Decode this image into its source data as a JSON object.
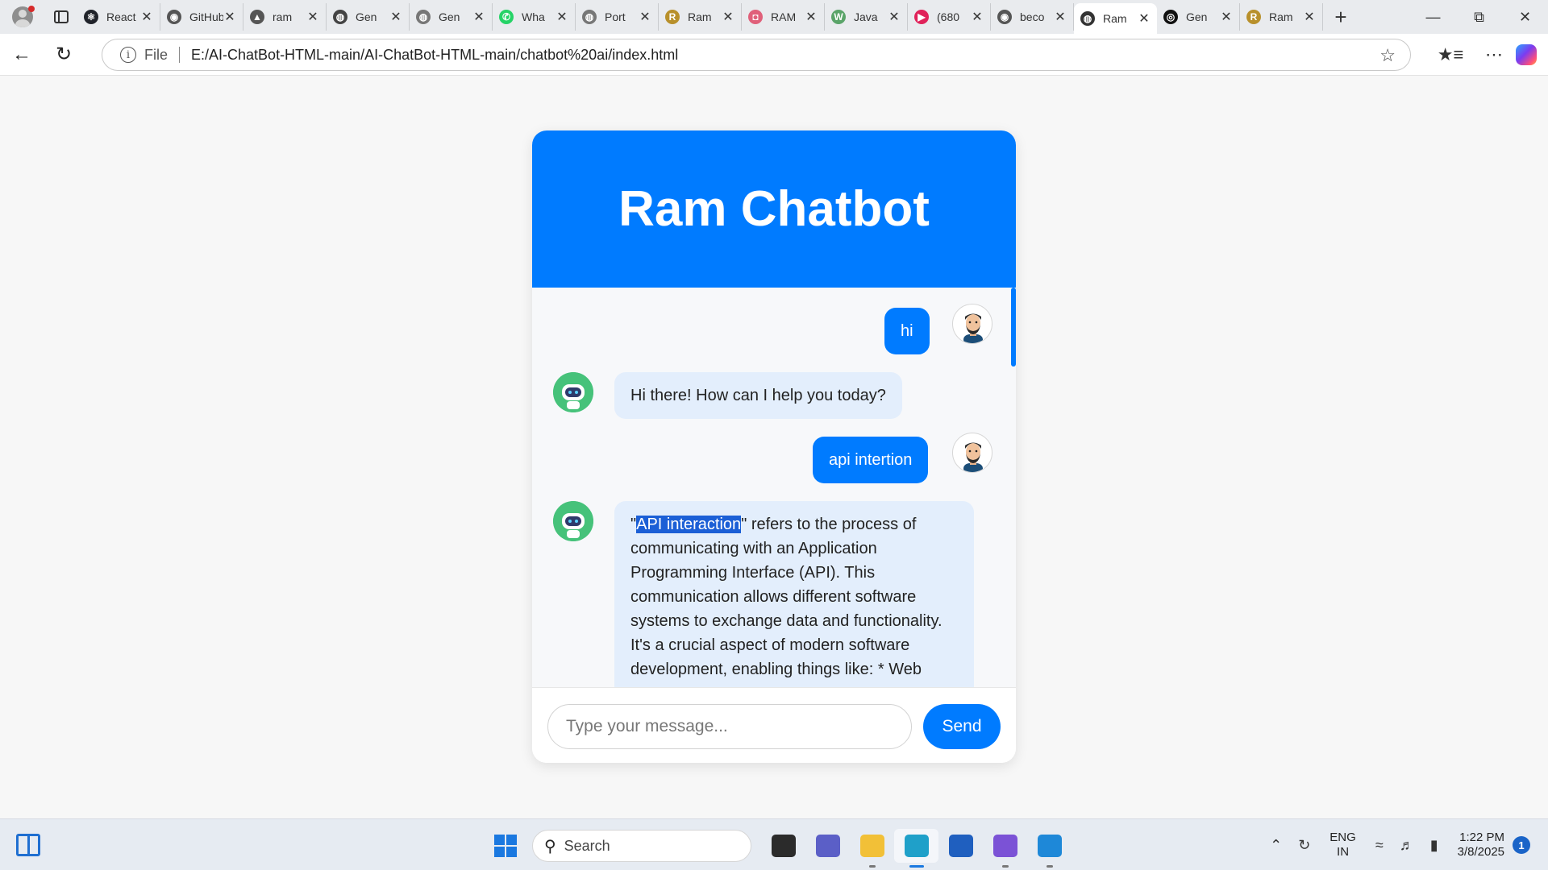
{
  "browser": {
    "tabs": [
      {
        "title": "React",
        "fav_color": "#20232a",
        "fav_glyph": "⚛"
      },
      {
        "title": "GitHub",
        "fav_color": "#555555",
        "fav_glyph": "◉"
      },
      {
        "title": "ram",
        "fav_color": "#555555",
        "fav_glyph": "▲"
      },
      {
        "title": "Gen",
        "fav_color": "#444444",
        "fav_glyph": "◍"
      },
      {
        "title": "Gen",
        "fav_color": "#777777",
        "fav_glyph": "◍"
      },
      {
        "title": "Wha",
        "fav_color": "#25d366",
        "fav_glyph": "✆"
      },
      {
        "title": "Port",
        "fav_color": "#777777",
        "fav_glyph": "◍"
      },
      {
        "title": "Ram",
        "fav_color": "#b8902b",
        "fav_glyph": "R"
      },
      {
        "title": "RAM",
        "fav_color": "#e0607a",
        "fav_glyph": "◘"
      },
      {
        "title": "Java",
        "fav_color": "#5aa469",
        "fav_glyph": "W"
      },
      {
        "title": "(680",
        "fav_color": "#e0225a",
        "fav_glyph": "▶"
      },
      {
        "title": "beco",
        "fav_color": "#555555",
        "fav_glyph": "◉"
      },
      {
        "title": "Ram",
        "fav_color": "#333333",
        "fav_glyph": "◍",
        "active": true
      },
      {
        "title": "Gen",
        "fav_color": "#111111",
        "fav_glyph": "◎"
      },
      {
        "title": "Ram",
        "fav_color": "#b8902b",
        "fav_glyph": "R"
      }
    ],
    "address": {
      "scheme": "File",
      "url": "E:/AI-ChatBot-HTML-main/AI-ChatBot-HTML-main/chatbot%20ai/index.html"
    }
  },
  "chat": {
    "title": "Ram Chatbot",
    "messages": [
      {
        "role": "user",
        "text": "hi"
      },
      {
        "role": "bot",
        "text": "Hi there! How can I help you today?"
      },
      {
        "role": "user",
        "text": "api intertion"
      },
      {
        "role": "bot",
        "quote_open": "\"",
        "highlight": "API interaction",
        "text_rest": "\" refers to the process of communicating with an Application Programming Interface (API). This communication allows different software systems to exchange data and functionality. It's a crucial aspect of modern software development, enabling things like: * Web"
      }
    ],
    "input_placeholder": "Type your message...",
    "send_label": "Send"
  },
  "taskbar": {
    "search_label": "Search",
    "lang_top": "ENG",
    "lang_bottom": "IN",
    "time": "1:22 PM",
    "date": "3/8/2025",
    "notification_count": "1",
    "apps": [
      {
        "name": "task-view",
        "color": "#2b2b2b"
      },
      {
        "name": "teams",
        "color": "#5b5fc7"
      },
      {
        "name": "file-explorer",
        "color": "#f2c037"
      },
      {
        "name": "edge",
        "color": "#1fa0c9",
        "active": true
      },
      {
        "name": "store",
        "color": "#1f5fbf"
      },
      {
        "name": "m365",
        "color": "#7b52d6"
      },
      {
        "name": "vscode",
        "color": "#1e88d8"
      }
    ]
  }
}
